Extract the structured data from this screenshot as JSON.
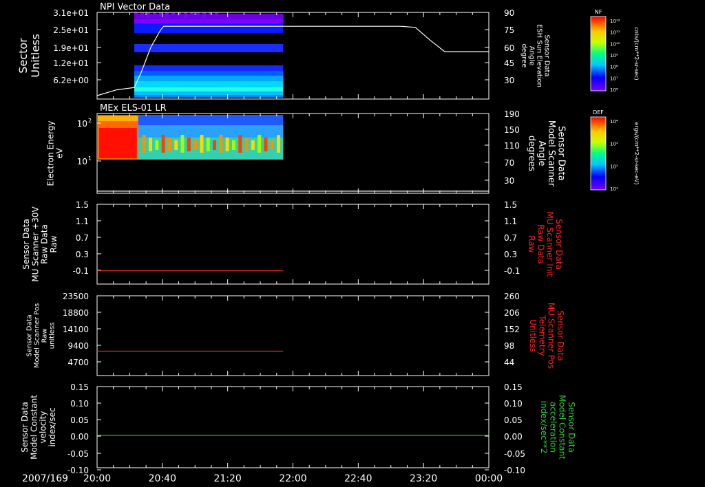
{
  "colors": {
    "background": "#000000",
    "axis": "#ffffff",
    "red_trace": "#ff2020",
    "green_trace": "#33cc33",
    "text": "#ffffff"
  },
  "time_axis": {
    "date_label": "2007/169",
    "tick_labels": [
      "20:00",
      "20:40",
      "21:20",
      "22:00",
      "22:40",
      "23:20",
      "00:00"
    ],
    "range_hours": [
      20.0,
      24.0
    ],
    "data_end_hour": 21.9
  },
  "panels": [
    {
      "id": "npi",
      "title": "NPI Vector Data",
      "left_label": [
        "Sector",
        "Unitless"
      ],
      "left_ticks": [
        "3.1e+01",
        "2.5e+01",
        "1.9e+01",
        "1.2e+01",
        "6.2e+00"
      ],
      "right_label": [
        "Sensor Data",
        "ESH Sun Elevation",
        "Angle",
        "degree"
      ],
      "right_ticks": [
        "90",
        "75",
        "60",
        "45",
        "30"
      ],
      "colorbar": {
        "title": "NF",
        "unit": "cnts/(cm**2-sr-sec)",
        "labels": [
          "10^12",
          "10^11",
          "10^10",
          "10^9",
          "10^8",
          "10^7",
          "10^6"
        ]
      }
    },
    {
      "id": "els",
      "title": "MEx ELS-01 LR",
      "left_label": [
        "Electron Energy",
        "eV"
      ],
      "left_ticks": [
        "10^2",
        "10^1"
      ],
      "right_label": [
        "Sensor Data",
        "Model Scanner",
        "Angle",
        "degrees"
      ],
      "right_ticks": [
        "190",
        "150",
        "110",
        "70",
        "30"
      ],
      "colorbar": {
        "title": "DEF",
        "unit": "ergs/(cm**2-sr-sec-eV)",
        "labels": [
          "10^4",
          "10^3",
          "10^2",
          "10^1"
        ]
      }
    },
    {
      "id": "mu_raw",
      "left_label": [
        "Sensor Data",
        "MU Scanner +30V",
        "Raw Data",
        "Raw"
      ],
      "left_ticks": [
        "1.5",
        "1.1",
        "0.7",
        "0.3",
        "-0.1"
      ],
      "right_label": [
        "Sensor Data",
        "MU Scanner Init",
        "Raw Data",
        "Raw"
      ],
      "right_ticks": [
        "1.5",
        "1.1",
        "0.7",
        "0.3",
        "-0.1"
      ]
    },
    {
      "id": "pos",
      "left_label": [
        "Sensor Data",
        "Model Scanner Pos",
        "Raw",
        "unitless"
      ],
      "left_ticks": [
        "23500",
        "18800",
        "14100",
        "9400",
        "4700"
      ],
      "right_label": [
        "Sensor Data",
        "MU Scanner Pos",
        "Telemetry",
        "Unitless"
      ],
      "right_ticks": [
        "260",
        "206",
        "152",
        "98",
        "44"
      ]
    },
    {
      "id": "vel",
      "left_label": [
        "Sensor Data",
        "Model Constant",
        "velocity",
        "index/sec"
      ],
      "left_ticks": [
        "0.15",
        "0.10",
        "0.05",
        "0.00",
        "-0.05",
        "-0.10"
      ],
      "right_label": [
        "Sensor Data",
        "Model Constant",
        "acceleration",
        "index/sec**2"
      ],
      "right_ticks": [
        "0.15",
        "0.10",
        "0.05",
        "0.00",
        "-0.05",
        "-0.10"
      ]
    }
  ],
  "chart_data": [
    {
      "type": "line",
      "panel": "npi",
      "title": "NPI Vector Data",
      "x_unit": "hours UT",
      "series": [
        {
          "name": "ESH Sun Elevation Angle",
          "unit": "degree",
          "x": [
            20.0,
            20.2,
            20.38,
            20.45,
            20.55,
            20.65,
            20.68,
            21.0,
            22.0,
            22.5,
            23.0,
            23.1,
            23.25,
            23.4,
            23.55,
            23.7,
            24.0
          ],
          "y": [
            18,
            23,
            25,
            38,
            60,
            75,
            78,
            78,
            78,
            78,
            78,
            78,
            77,
            66,
            56,
            56,
            56
          ]
        }
      ],
      "ylim_right": [
        15,
        90
      ],
      "spectrogram": {
        "quantity": "NF",
        "x_range": [
          20.38,
          21.9
        ],
        "sector_range": [
          0,
          31
        ]
      }
    },
    {
      "type": "heatmap",
      "panel": "els",
      "title": "MEx ELS-01 LR",
      "ylabel": "Electron Energy (eV)",
      "x_range": [
        20.0,
        21.9
      ],
      "y_range_eV": [
        10,
        150
      ],
      "quantity": "DEF",
      "series": [
        {
          "name": "Model Scanner Angle",
          "unit": "degrees",
          "x": [
            20.0,
            24.0
          ],
          "y": [
            5,
            5
          ]
        }
      ],
      "ylim_right": [
        0,
        190
      ]
    },
    {
      "type": "line",
      "panel": "mu_raw",
      "series": [
        {
          "name": "MU Scanner +30V Raw Data",
          "x": [
            20.0,
            21.9
          ],
          "y": [
            0.0,
            0.0
          ]
        }
      ],
      "ylim": [
        -0.3,
        1.5
      ]
    },
    {
      "type": "line",
      "panel": "pos",
      "series": [
        {
          "name": "Model Scanner Pos",
          "x": [
            20.0,
            21.9
          ],
          "y": [
            7200,
            7200
          ]
        }
      ],
      "ylim": [
        0,
        23500
      ]
    },
    {
      "type": "line",
      "panel": "vel",
      "series": [
        {
          "name": "Model Constant velocity",
          "x": [
            20.0,
            24.0
          ],
          "y": [
            0.0,
            0.0
          ]
        }
      ],
      "ylim": [
        -0.1,
        0.15
      ]
    }
  ]
}
